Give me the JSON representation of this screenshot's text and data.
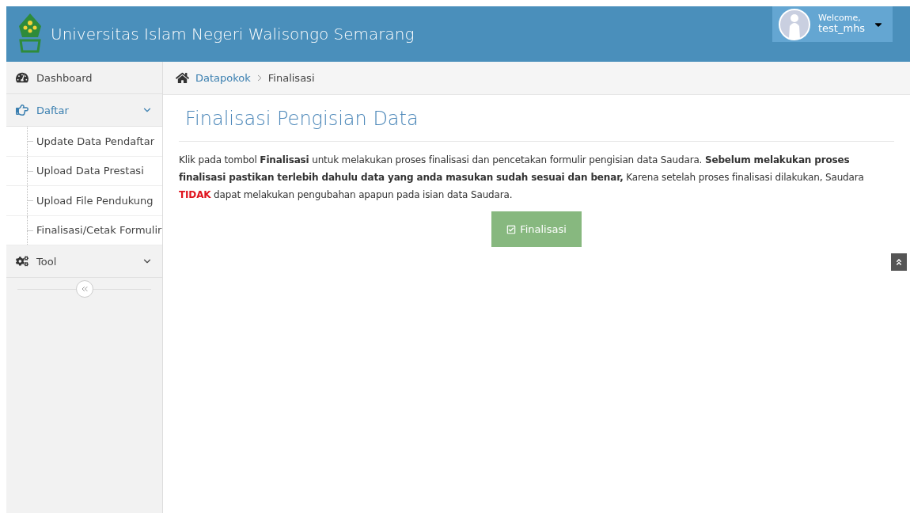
{
  "header": {
    "title": "Universitas Islam Negeri Walisongo Semarang",
    "user": {
      "greeting": "Welcome,",
      "name": "test_mhs"
    }
  },
  "sidebar": {
    "items": [
      {
        "label": "Dashboard",
        "kind": "dashboard",
        "expandable": false,
        "expanded": false
      },
      {
        "label": "Daftar",
        "kind": "register",
        "expandable": true,
        "expanded": true,
        "children": [
          {
            "label": "Update Data Pendaftar"
          },
          {
            "label": "Upload Data Prestasi"
          },
          {
            "label": "Upload File Pendukung"
          },
          {
            "label": "Finalisasi/Cetak Formulir"
          }
        ]
      },
      {
        "label": "Tool",
        "kind": "tool",
        "expandable": true,
        "expanded": false
      }
    ]
  },
  "breadcrumb": [
    {
      "label": "Datapokok",
      "kind": "link"
    },
    {
      "label": "Finalisasi",
      "kind": "current"
    }
  ],
  "page": {
    "title": "Finalisasi Pengisian Data",
    "message": [
      {
        "kind": "normal",
        "text": "Klik pada tombol "
      },
      {
        "kind": "bold",
        "text": "Finalisasi"
      },
      {
        "kind": "normal",
        "text": " untuk melakukan proses finalisasi dan pencetakan formulir pengisian data Saudara. "
      },
      {
        "kind": "bold",
        "text": "Sebelum melakukan proses finalisasi pastikan terlebih dahulu data yang anda masukan sudah sesuai dan benar,"
      },
      {
        "kind": "normal",
        "text": " Karena setelah proses finalisasi dilakukan, Saudara "
      },
      {
        "kind": "alert",
        "text": "TIDAK"
      },
      {
        "kind": "normal",
        "text": " dapat melakukan pengubahan apapun pada isian data Saudara."
      }
    ],
    "button": "Finalisasi"
  }
}
